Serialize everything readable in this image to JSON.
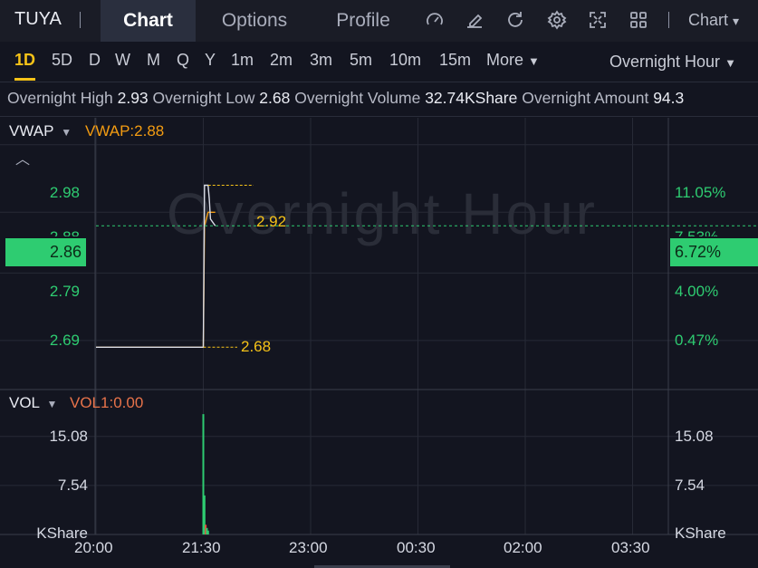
{
  "header": {
    "symbol": "TUYA",
    "tabs": [
      {
        "label": "Chart",
        "active": true
      },
      {
        "label": "Options",
        "active": false
      },
      {
        "label": "Profile",
        "active": false
      }
    ],
    "tools": [
      "gauge-icon",
      "draw-icon",
      "refresh-icon",
      "settings-icon",
      "fullscreen-icon",
      "layout-grid-icon"
    ],
    "chart_menu_label": "Chart"
  },
  "periods": {
    "items": [
      "1D",
      "5D",
      "D",
      "W",
      "M",
      "Q",
      "Y",
      "1m",
      "2m",
      "3m",
      "5m",
      "10m",
      "15m"
    ],
    "active": "1D",
    "more_label": "More",
    "session_label": "Overnight Hour"
  },
  "stats": {
    "high_label": "Overnight High",
    "high_value": "2.93",
    "low_label": "Overnight Low",
    "low_value": "2.68",
    "volume_label": "Overnight Volume",
    "volume_value": "32.74KShare",
    "amount_label": "Overnight Amount",
    "amount_value": "94.3"
  },
  "price_panel": {
    "indicator_name": "VWAP",
    "indicator_value": "VWAP:2.88",
    "watermark": "Overnight Hour",
    "left_axis": [
      "2.98",
      "2.88",
      "2.79",
      "2.69"
    ],
    "right_axis": [
      "11.05%",
      "7.53%",
      "4.00%",
      "0.47%"
    ],
    "current_price": "2.86",
    "current_change": "6.72%",
    "high_marker": "2.92",
    "low_marker": "2.68"
  },
  "vol_panel": {
    "indicator_name": "VOL",
    "indicator_value": "VOL1:0.00",
    "left_axis": [
      "15.08",
      "7.54",
      "KShare"
    ],
    "right_axis": [
      "15.08",
      "7.54",
      "KShare"
    ]
  },
  "time_axis": [
    "20:00",
    "21:30",
    "23:00",
    "00:30",
    "02:00",
    "03:30"
  ],
  "colors": {
    "up": "#2ecc71",
    "down": "#e74c3c",
    "vwap": "#f39c12",
    "accent": "#f5c218",
    "background": "#131520"
  },
  "chart_data": {
    "type": "line",
    "x": [
      "20:00",
      "21:30",
      "21:31",
      "21:34",
      "21:35",
      "21:36",
      "21:40"
    ],
    "series": [
      {
        "name": "VWAP",
        "values": [
          2.68,
          2.68,
          2.86,
          2.88,
          2.88,
          2.88,
          2.88
        ]
      },
      {
        "values": [
          2.68,
          2.68,
          2.92,
          2.92,
          2.9,
          2.87,
          2.86
        ]
      }
    ],
    "volume_x": [
      "21:30",
      "21:31",
      "21:32",
      "21:33",
      "21:34"
    ],
    "volume": [
      18.5,
      6.0,
      1.5,
      1.0,
      0.6
    ],
    "ylim": [
      2.62,
      3.02
    ],
    "vol_ylim": [
      0,
      22
    ]
  }
}
